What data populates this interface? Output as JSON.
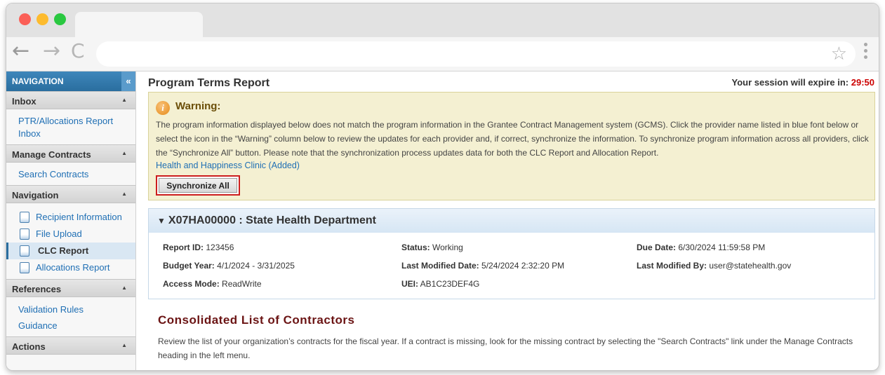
{
  "browser": {
    "back_glyph": "←",
    "forward_glyph": "→",
    "reload_glyph": "C",
    "star_glyph": "☆"
  },
  "sidebar": {
    "header": "NAVIGATION",
    "collapse_glyph": "«",
    "inbox": {
      "title": "Inbox",
      "link": "PTR/Allocations Report Inbox"
    },
    "manage_contracts": {
      "title": "Manage Contracts",
      "link": "Search Contracts"
    },
    "navigation": {
      "title": "Navigation",
      "items": [
        {
          "label": "Recipient Information"
        },
        {
          "label": "File Upload"
        },
        {
          "label": "CLC Report"
        },
        {
          "label": "Allocations Report"
        }
      ]
    },
    "references": {
      "title": "References",
      "links": [
        "Validation Rules",
        "Guidance"
      ]
    },
    "actions": {
      "title": "Actions"
    },
    "caret": "▲"
  },
  "main": {
    "title": "Program Terms Report",
    "session_label": "Your session will expire in:",
    "session_timer": "29:50",
    "warning": {
      "icon_glyph": "i",
      "title": "Warning:",
      "text": "The program information displayed below does not match the program information in the Grantee Contract Management system (GCMS). Click the provider name listed in blue font below or select the icon in the “Warning” column below to review the updates for each provider and, if correct, synchronize the information. To synchronize program information across all providers, click the “Synchronize All” button. Please note that the synchronization process updates data for both the CLC Report and Allocation Report.",
      "link": "Health and Happiness Clinic (Added)",
      "button": "Synchronize All"
    },
    "grantee": {
      "toggle_glyph": "▼",
      "title": "X07HA00000 : State Health Department",
      "fields": {
        "report_id_label": "Report ID:",
        "report_id": "123456",
        "status_label": "Status:",
        "status": "Working",
        "due_date_label": "Due Date:",
        "due_date": "6/30/2024 11:59:58 PM",
        "budget_year_label": "Budget Year:",
        "budget_year": "4/1/2024 - 3/31/2025",
        "last_modified_date_label": "Last Modified Date:",
        "last_modified_date": "5/24/2024  2:32:20 PM",
        "last_modified_by_label": "Last Modified By:",
        "last_modified_by": "user@statehealth.gov",
        "access_mode_label": "Access Mode:",
        "access_mode": "ReadWrite",
        "uei_label": "UEI:",
        "uei": "AB1C23DEF4G"
      }
    },
    "clc": {
      "title": "Consolidated List of Contractors",
      "text": "Review the list of your organization’s contracts for the fiscal year. If a contract is missing, look for the missing contract by selecting the \"Search Contracts\" link under the Manage Contracts heading in the left menu."
    }
  }
}
